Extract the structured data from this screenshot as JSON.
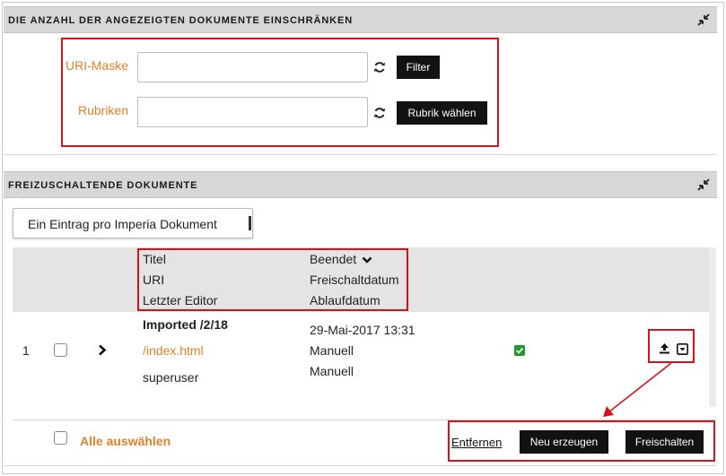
{
  "filter_section": {
    "title": "DIE ANZAHL DER ANGEZEIGTEN DOKUMENTE EINSCHRÄNKEN",
    "collapse_icon": "collapse-icon",
    "uri_mask_label": "URI-Maske",
    "uri_mask_value": "",
    "filter_button": "Filter",
    "rubriken_label": "Rubriken",
    "rubriken_value": "",
    "rubrik_button": "Rubrik wählen",
    "refresh_icon": "refresh-icon"
  },
  "documents_section": {
    "title": "FREIZUSCHALTENDE DOKUMENTE",
    "collapse_icon": "collapse-icon",
    "view_select": "Ein Eintrag pro Imperia Dokument",
    "columns": {
      "titel": "Titel",
      "uri": "URI",
      "letzter_editor": "Letzter Editor",
      "beendet": "Beendet",
      "freischaltdatum": "Freischaltdatum",
      "ablaufdatum": "Ablaufdatum"
    },
    "rows": [
      {
        "number": "1",
        "title": "Imported /2/18",
        "uri": "/index.html",
        "editor": "superuser",
        "finished": "29-Mai-2017 13:31",
        "publish_date": "Manuell",
        "expiry_date": "Manuell"
      }
    ]
  },
  "footer": {
    "select_all": "Alle auswählen",
    "remove_link": "Entfernen",
    "create_button": "Neu erzeugen",
    "publish_button": "Freischalten"
  },
  "colors": {
    "accent_orange": "#e2812b",
    "annotation_red": "#d4141c",
    "status_green": "#1e9a2b"
  }
}
